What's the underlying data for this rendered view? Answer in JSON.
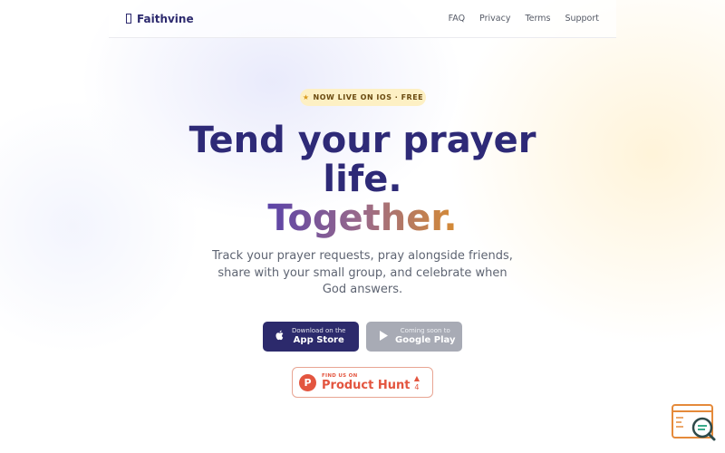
{
  "brand": {
    "name": "Faithvine",
    "icon": "bookmark-icon"
  },
  "nav": {
    "links": [
      "FAQ",
      "Privacy",
      "Terms",
      "Support"
    ]
  },
  "hero": {
    "badge": "NOW LIVE ON IOS · FREE",
    "badge_icon": "★",
    "headline_line1": "Tend your prayer",
    "headline_line2": "life.",
    "headline_accent": "Together.",
    "subtitle": "Track your prayer requests, pray alongside friends, share with your small group, and celebrate when God answers."
  },
  "buttons": {
    "app_store": {
      "small": "Download on the",
      "big": "App Store",
      "icon": "apple-icon"
    },
    "google_play": {
      "small": "Coming soon to",
      "big": "Google Play",
      "icon": "play-icon"
    }
  },
  "product_hunt": {
    "small": "FIND US ON",
    "big": "Product Hunt",
    "logo_letter": "P",
    "arrow": "▲",
    "votes": "4"
  },
  "colors": {
    "primary": "#2c2a6c",
    "accent_start": "#5b43a8",
    "accent_end": "#d68b33",
    "badge_bg": "#fdf0c4",
    "product_hunt": "#e3553f"
  }
}
